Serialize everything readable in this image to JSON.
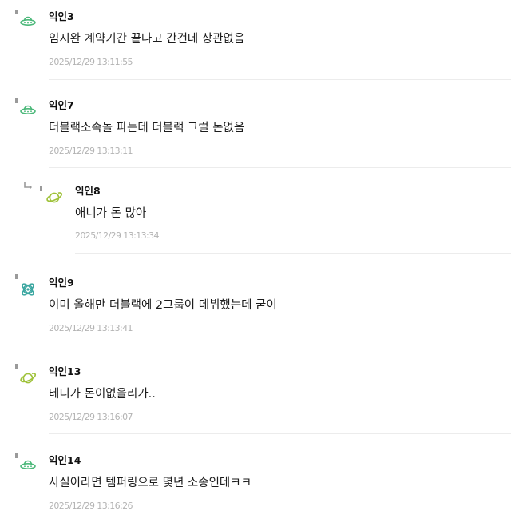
{
  "comments": [
    {
      "author": "익인3",
      "text": "임시완 계약기간 끝나고 간건데 상관없음",
      "timestamp": "2025/12/29 13:11:55",
      "avatar_icon": "ufo-icon",
      "avatar_color": "#4cb87a"
    },
    {
      "author": "익인7",
      "text": "더블랙소속돌 파는데 더블랙 그럴 돈없음",
      "timestamp": "2025/12/29 13:13:11",
      "avatar_icon": "ufo-icon",
      "avatar_color": "#4cb87a"
    },
    {
      "author": "익인8",
      "text": "애니가 돈 많아",
      "timestamp": "2025/12/29 13:13:34",
      "avatar_icon": "planet-icon",
      "avatar_color": "#9fc23a",
      "is_reply": true
    },
    {
      "author": "익인9",
      "text": "이미 올해만 더블랙에 2그룹이 데뷔했는데 굳이",
      "timestamp": "2025/12/29 13:13:41",
      "avatar_icon": "atom-icon",
      "avatar_color": "#3aa6a0"
    },
    {
      "author": "익인13",
      "text": "테디가 돈이없을리가..",
      "timestamp": "2025/12/29 13:16:07",
      "avatar_icon": "planet-icon",
      "avatar_color": "#9fc23a"
    },
    {
      "author": "익인14",
      "text": "사실이라면 템퍼링으로 몇년 소송인데ㅋㅋ",
      "timestamp": "2025/12/29 13:16:26",
      "avatar_icon": "ufo-icon",
      "avatar_color": "#4cb87a"
    }
  ]
}
